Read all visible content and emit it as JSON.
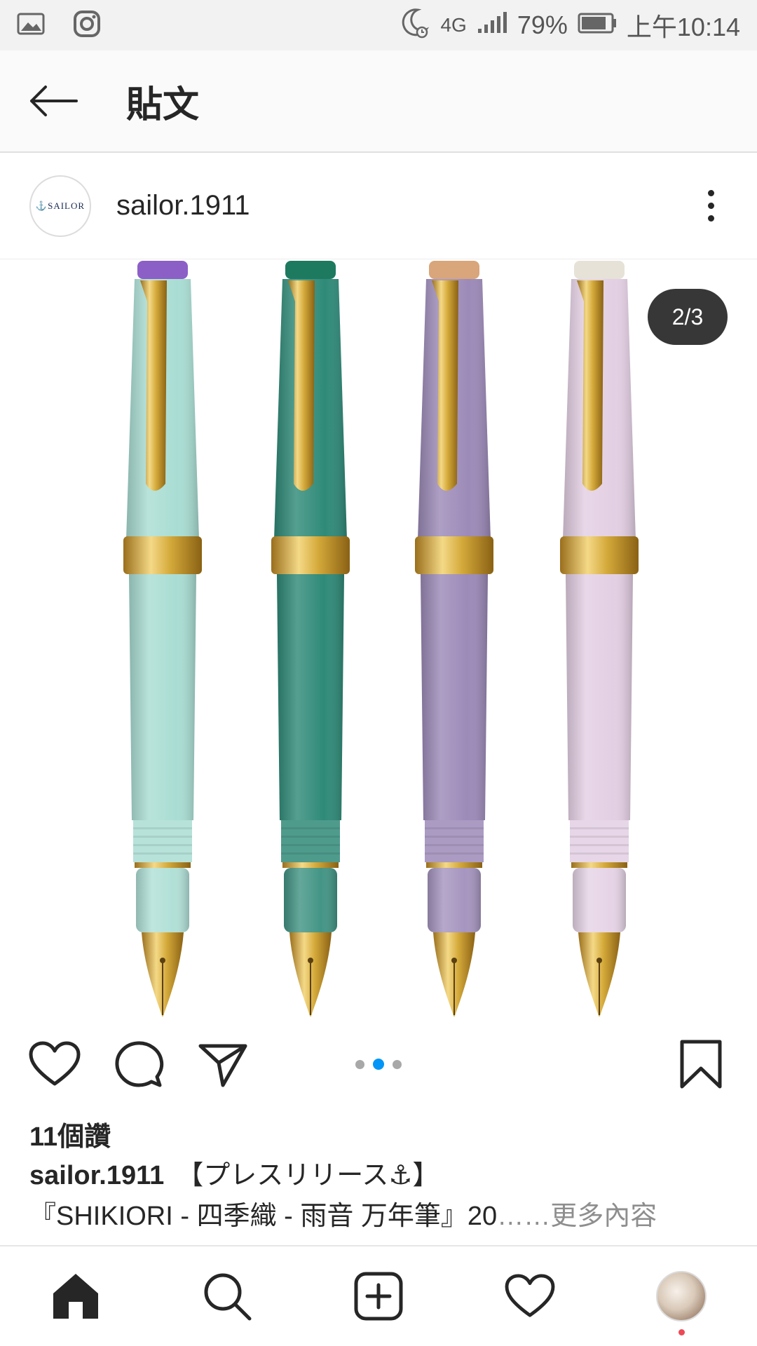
{
  "status_bar": {
    "network": "4G",
    "battery": "79%",
    "time": "上午10:14"
  },
  "header": {
    "title": "貼文"
  },
  "post": {
    "avatar_text": "⚓SAILOR",
    "username": "sailor.1911",
    "page_indicator": "2/3",
    "carousel": {
      "current": 2,
      "total": 3
    },
    "likes": "11個讚",
    "caption_user": "sailor.1911",
    "caption_line1": "【プレスリリース⚓】",
    "caption_line2": "『SHIKIORI - 四季織 - 雨音 万年筆』20",
    "caption_ellipsis": "……",
    "caption_more": "更多內容",
    "pen_colors": [
      "#a9ddd3",
      "#2f8a78",
      "#9c8ab8",
      "#e3cfe3"
    ],
    "pen_cap_top_colors": [
      "#8c5fc7",
      "#1e7a5e",
      "#d9a57a",
      "#e6e2d8"
    ]
  },
  "colors": {
    "accent_blue": "#0095f6",
    "text": "#262626",
    "gold": "#d4a93a"
  }
}
